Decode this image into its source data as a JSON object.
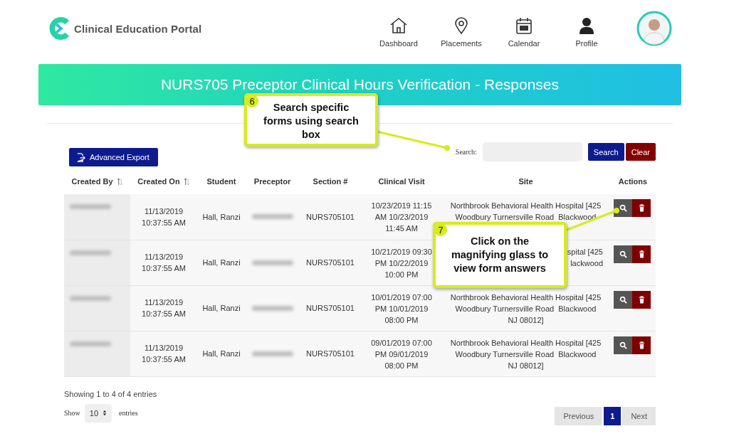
{
  "header": {
    "logo_text": "Clinical Education Portal",
    "nav": [
      {
        "label": "Dashboard",
        "kind": "home"
      },
      {
        "label": "Placements",
        "kind": "pin"
      },
      {
        "label": "Calendar",
        "kind": "calendar"
      },
      {
        "label": "Profile",
        "kind": "person"
      }
    ]
  },
  "banner": {
    "title": "NURS705 Preceptor Clinical Hours Verification - Responses"
  },
  "toolbar": {
    "export_button": "Advanced Export",
    "search_label": "Search:",
    "search_button": "Search",
    "clear_button": "Clear"
  },
  "table": {
    "columns": [
      {
        "label": "Created By",
        "sortable": true
      },
      {
        "label": "Created On",
        "sortable": true
      },
      {
        "label": "Student",
        "sortable": false
      },
      {
        "label": "Preceptor",
        "sortable": false
      },
      {
        "label": "Section #",
        "sortable": false
      },
      {
        "label": "Clinical Visit",
        "sortable": false
      },
      {
        "label": "Site",
        "sortable": false
      },
      {
        "label": "Actions",
        "sortable": false
      }
    ],
    "rows": [
      {
        "created_by": {
          "redacted": true
        },
        "created_on": "11/13/2019 10:37:55 AM",
        "student": "Hall, Ranzi",
        "preceptor": {
          "redacted": true
        },
        "section": "NURS705101",
        "clinical_visit": "10/23/2019 11:15 AM 10/23/2019 11:45 AM",
        "site_lines": [
          "Northbrook Behavioral Health Hospital [425",
          "Woodbury Turnersville Road  Blackwood"
        ],
        "site_covered": false
      },
      {
        "created_by": {
          "redacted": true
        },
        "created_on": "11/13/2019 10:37:55 AM",
        "student": "Hall, Ranzi",
        "preceptor": {
          "redacted": true
        },
        "section": "NURS705101",
        "clinical_visit": "10/21/2019 09:30 PM 10/22/2019 10:00 PM",
        "site_lines": [
          "spital [425",
          "lackwood"
        ],
        "site_covered": true
      },
      {
        "created_by": {
          "redacted": true
        },
        "created_on": "11/13/2019 10:37:55 AM",
        "student": "Hall, Ranzi",
        "preceptor": {
          "redacted": true
        },
        "section": "NURS705101",
        "clinical_visit": "10/01/2019 07:00 PM 10/01/2019 08:00 PM",
        "site_lines": [
          "Northbrook Behavioral Health Hospital [425",
          "Woodbury Turnersville Road  Blackwood",
          "NJ 08012]"
        ],
        "site_covered": false
      },
      {
        "created_by": {
          "redacted": true
        },
        "created_on": "11/13/2019 10:37:55 AM",
        "student": "Hall, Ranzi",
        "preceptor": {
          "redacted": true
        },
        "section": "NURS705101",
        "clinical_visit": "09/01/2019 07:00 PM 09/01/2019 08:00 PM",
        "site_lines": [
          "Northbrook Behavioral Health Hospital [425",
          "Woodbury Turnersville Road  Blackwood",
          "NJ 08012]"
        ],
        "site_covered": false
      }
    ]
  },
  "footer": {
    "info": "Showing 1 to 4 of 4 entries",
    "show_label": "Show",
    "page_size": "10",
    "entries_label": "entries",
    "pagination": [
      {
        "label": "Previous",
        "selected": false
      },
      {
        "label": "1",
        "selected": true
      },
      {
        "label": "Next",
        "selected": false
      }
    ]
  },
  "callouts": [
    {
      "number": "6",
      "text": "Search specific forms using search box"
    },
    {
      "number": "7",
      "text": "Click on the magnifying glass to view form answers"
    }
  ]
}
